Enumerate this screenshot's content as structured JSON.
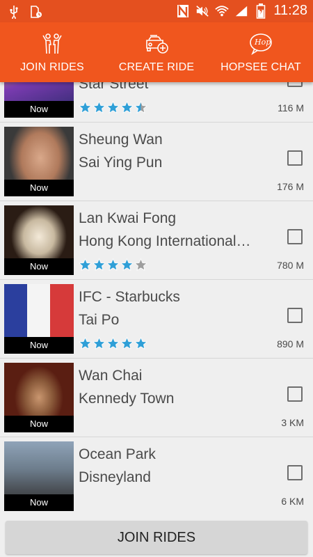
{
  "status_bar": {
    "time": "11:28",
    "left_icons": [
      "usb-icon",
      "sim-card-icon"
    ],
    "right_icons": [
      "nfc-icon",
      "mute-icon",
      "wifi-icon",
      "signal-icon",
      "battery-icon"
    ]
  },
  "colors": {
    "brand": "#f0561e",
    "status_bar": "#e4501f",
    "star": "#2f9fd7",
    "star_empty": "#9e9e9e"
  },
  "nav": {
    "tabs": [
      {
        "label": "JOIN RIDES",
        "icon": "people-icon"
      },
      {
        "label": "CREATE RIDE",
        "icon": "car-add-icon"
      },
      {
        "label": "HOPSEE CHAT",
        "icon": "chat-bubble-icon",
        "icon_text": "Hop"
      }
    ]
  },
  "rides": [
    {
      "from": "",
      "to": "Star Street",
      "time": "Now",
      "rating": 4.5,
      "distance": "116 M"
    },
    {
      "from": "Sheung Wan",
      "to": "Sai Ying Pun",
      "time": "Now",
      "rating": null,
      "distance": "176 M"
    },
    {
      "from": "Lan Kwai Fong",
      "to": "Hong Kong International…",
      "time": "Now",
      "rating": 4,
      "distance": "780 M"
    },
    {
      "from": "IFC - Starbucks",
      "to": "Tai Po",
      "time": "Now",
      "rating": 5,
      "distance": "890 M"
    },
    {
      "from": "Wan Chai",
      "to": "Kennedy Town",
      "time": "Now",
      "rating": null,
      "distance": "3 KM"
    },
    {
      "from": "Ocean Park",
      "to": "Disneyland",
      "time": "Now",
      "rating": null,
      "distance": "6 KM"
    }
  ],
  "bottom_button": {
    "label": "JOIN RIDES"
  }
}
